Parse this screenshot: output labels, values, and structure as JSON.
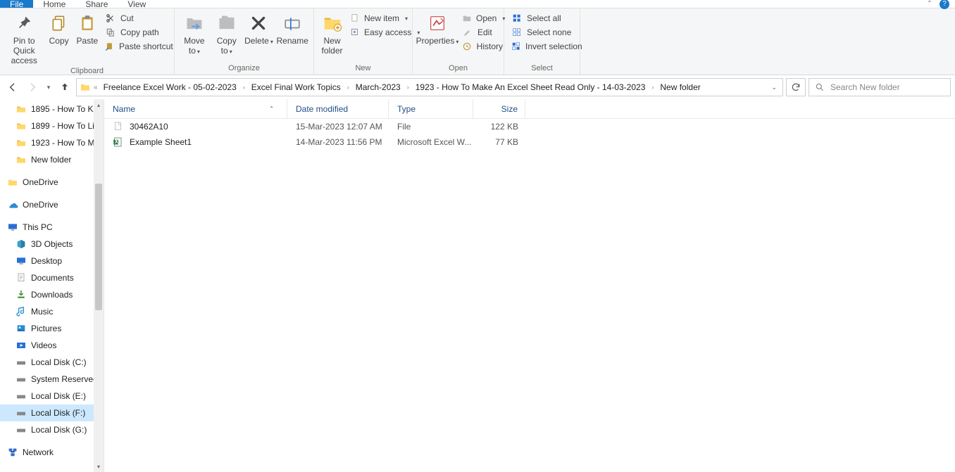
{
  "tabs": {
    "file": "File",
    "home": "Home",
    "share": "Share",
    "view": "View"
  },
  "ribbon": {
    "clipboard": {
      "label": "Clipboard",
      "pin": "Pin to Quick access",
      "copy": "Copy",
      "paste": "Paste",
      "cut": "Cut",
      "copypath": "Copy path",
      "pasteshortcut": "Paste shortcut"
    },
    "organize": {
      "label": "Organize",
      "moveto": "Move to",
      "copyto": "Copy to",
      "delete": "Delete",
      "rename": "Rename"
    },
    "new": {
      "label": "New",
      "newfolder": "New folder",
      "newitem": "New item",
      "easyaccess": "Easy access"
    },
    "open": {
      "label": "Open",
      "properties": "Properties",
      "open": "Open",
      "edit": "Edit",
      "history": "History"
    },
    "select": {
      "label": "Select",
      "selectall": "Select all",
      "selectnone": "Select none",
      "invert": "Invert selection"
    }
  },
  "breadcrumbs": [
    "Freelance Excel Work - 05-02-2023",
    "Excel Final Work Topics",
    "March-2023",
    "1923 - How To Make An Excel Sheet Read Only - 14-03-2023",
    "New folder"
  ],
  "search": {
    "placeholder": "Search New folder"
  },
  "sidebar": {
    "items": [
      {
        "icon": "folder",
        "label": "1895 - How To K"
      },
      {
        "icon": "folder",
        "label": "1899 - How To Li"
      },
      {
        "icon": "folder",
        "label": "1923 - How To M"
      },
      {
        "icon": "folder",
        "label": "New folder"
      },
      {
        "icon": "onedrive-y",
        "label": "OneDrive",
        "l1": true,
        "gapBefore": true
      },
      {
        "icon": "onedrive-b",
        "label": "OneDrive",
        "l1": true,
        "gapBefore": true
      },
      {
        "icon": "thispc",
        "label": "This PC",
        "l1": true,
        "gapBefore": true
      },
      {
        "icon": "objects3d",
        "label": "3D Objects"
      },
      {
        "icon": "desktop",
        "label": "Desktop"
      },
      {
        "icon": "documents",
        "label": "Documents"
      },
      {
        "icon": "downloads",
        "label": "Downloads"
      },
      {
        "icon": "music",
        "label": "Music"
      },
      {
        "icon": "pictures",
        "label": "Pictures"
      },
      {
        "icon": "videos",
        "label": "Videos"
      },
      {
        "icon": "drive",
        "label": "Local Disk (C:)"
      },
      {
        "icon": "drive",
        "label": "System Reservec"
      },
      {
        "icon": "drive",
        "label": "Local Disk (E:)"
      },
      {
        "icon": "drive",
        "label": "Local Disk (F:)",
        "sel": true
      },
      {
        "icon": "drive",
        "label": "Local Disk (G:)"
      },
      {
        "icon": "network",
        "label": "Network",
        "l1": true,
        "gapBefore": true
      }
    ]
  },
  "columns": {
    "name": "Name",
    "date": "Date modified",
    "type": "Type",
    "size": "Size"
  },
  "files": [
    {
      "icon": "file",
      "name": "30462A10",
      "date": "15-Mar-2023 12:07 AM",
      "type": "File",
      "size": "122 KB"
    },
    {
      "icon": "excel",
      "name": "Example Sheet1",
      "date": "14-Mar-2023 11:56 PM",
      "type": "Microsoft Excel W...",
      "size": "77 KB"
    }
  ]
}
